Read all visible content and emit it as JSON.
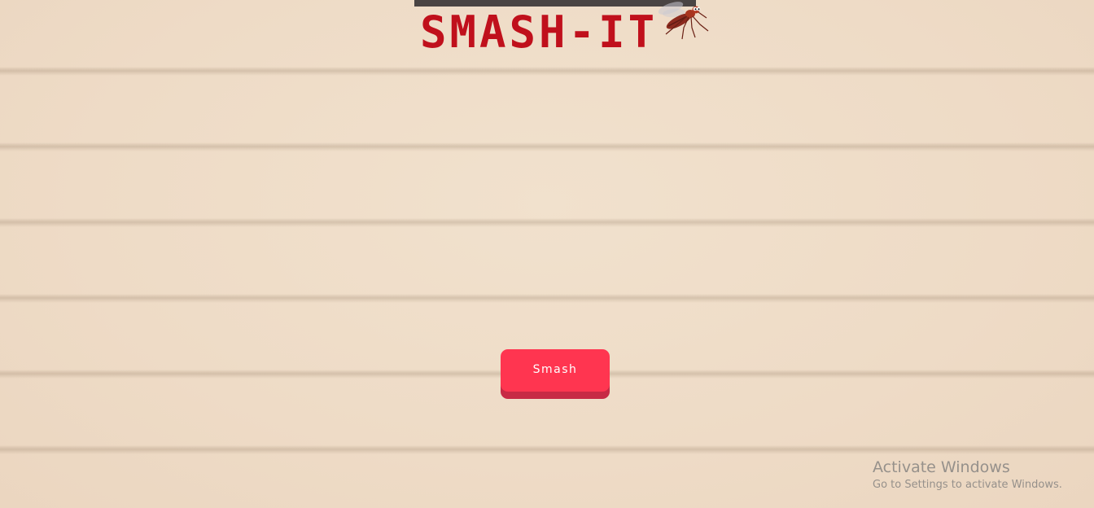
{
  "game": {
    "title": "SMASH-IT",
    "mascot_icon": "mosquito-icon",
    "smash_button_label": "Smash"
  },
  "system_watermark": {
    "title": "Activate Windows",
    "subtitle": "Go to Settings to activate Windows."
  },
  "colors": {
    "title_red": "#c0101c",
    "button_red": "#ff3550",
    "button_shadow": "#c72a45",
    "top_bar": "#4a4443",
    "background": "#efdfcb"
  }
}
